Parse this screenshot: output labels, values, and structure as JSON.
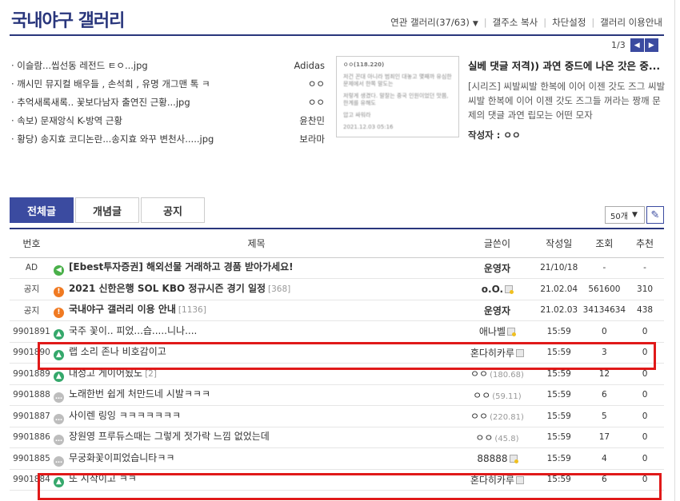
{
  "header": {
    "title": "국내야구 갤러리",
    "nav": [
      "연관 갤러리(37/63)",
      "갤주소 복사",
      "차단설정",
      "갤러리 이용안내"
    ],
    "pager": "1/3"
  },
  "featured": [
    {
      "title": "· 이슬람...씹선동 레전드 ㅌㅇ...jpg",
      "author": "Adidas"
    },
    {
      "title": "· 깨시민 뮤지컬 배우들 , 손석희 , 유명 개그맨 톡 ㅋ",
      "author": "ㅇㅇ"
    },
    {
      "title": "· 추억새록새록.. 꽃보다남자 출연진 근황...jpg",
      "author": "ㅇㅇ"
    },
    {
      "title": "· 속보) 문재앙식 K-방역 근황",
      "author": "윤찬민"
    },
    {
      "title": "· 황당) 송지효 코디논란...송지효 와꾸 변천사.....jpg",
      "author": "보라마"
    }
  ],
  "thumb": {
    "head": "ㅇㅇ(118.220)",
    "lines": [
      "저건 꼰대 아니라 범죄인 대놓고 몇째까 유심한 문제에서 한쪽 말도는",
      "저렇게 생겼다. 말잘는 중국 인원이었던 맛쯤, 한계를 유해도",
      "압고 싸워라",
      "2021.12.03 05:16"
    ]
  },
  "article": {
    "headline": "실베 댓글 저격)) 과연 중드에 나온 갓은 중...",
    "body": "[시리즈] 씨발씨발 한복에 이어 이젠 갓도 즈그 씨발씨발 한복에 이어 이젠 갓도 즈그들 꺼라는 짱깨 문제의 댓글 과연 립모는 어떤 모자",
    "author_label": "작성자 : ",
    "author": "ㅇㅇ"
  },
  "tabs": [
    "전체글",
    "개념글",
    "공지"
  ],
  "list_size": "50개",
  "columns": [
    "번호",
    "제목",
    "글쓴이",
    "작성일",
    "조회",
    "추천"
  ],
  "rows": [
    {
      "no": "AD",
      "icon": "speaker",
      "title": "[Ebest투자증권] 해외선물 거래하고 경품 받아가세요!",
      "bold": true,
      "cc": "",
      "writer": "운영자",
      "ip": "",
      "badge": "",
      "date": "21/10/18",
      "views": "-",
      "rec": "-"
    },
    {
      "no": "공지",
      "icon": "notice",
      "title": "2021 신한은행 SOL KBO 정규시즌 경기 일정",
      "bold": true,
      "cc": "[368]",
      "writer": "o.O.",
      "ip": "",
      "badge": "gold",
      "date": "21.02.04",
      "views": "561600",
      "rec": "310"
    },
    {
      "no": "공지",
      "icon": "notice",
      "title": "국내야구 갤러리 이용 안내",
      "bold": true,
      "cc": "[1136]",
      "writer": "운영자",
      "ip": "",
      "badge": "",
      "date": "21.02.03",
      "views": "34134634",
      "rec": "438"
    },
    {
      "no": "9901891",
      "icon": "img",
      "title": "국주 꽃이.. 피었...습.....니나....",
      "bold": false,
      "cc": "",
      "writer": "애나벨",
      "ip": "",
      "badge": "gold",
      "date": "15:59",
      "views": "0",
      "rec": "0"
    },
    {
      "no": "9901890",
      "icon": "img",
      "title": "랩 소리 존나 비호감이고",
      "bold": false,
      "cc": "",
      "writer": "혼다히카루",
      "ip": "",
      "badge": "gray",
      "date": "15:59",
      "views": "3",
      "rec": "0"
    },
    {
      "no": "9901889",
      "icon": "img",
      "title": "대성고 게이어됬노",
      "bold": false,
      "cc": "[2]",
      "writer": "ㅇㅇ",
      "ip": "(180.68)",
      "badge": "",
      "date": "15:59",
      "views": "12",
      "rec": "0"
    },
    {
      "no": "9901888",
      "icon": "txt",
      "title": "노래한번 쉽게 처만드네 시발ㅋㅋㅋ",
      "bold": false,
      "cc": "",
      "writer": "ㅇㅇ",
      "ip": "(59.11)",
      "badge": "",
      "date": "15:59",
      "views": "6",
      "rec": "0"
    },
    {
      "no": "9901887",
      "icon": "txt",
      "title": "사이렌 링잉 ㅋㅋㅋㅋㅋㅋㅋ",
      "bold": false,
      "cc": "",
      "writer": "ㅇㅇ",
      "ip": "(220.81)",
      "badge": "",
      "date": "15:59",
      "views": "5",
      "rec": "0"
    },
    {
      "no": "9901886",
      "icon": "txt",
      "title": "장원영 프루듀스때는 그렇게 젓가락 느낌 없었는데",
      "bold": false,
      "cc": "",
      "writer": "ㅇㅇ",
      "ip": "(45.8)",
      "badge": "",
      "date": "15:59",
      "views": "17",
      "rec": "0"
    },
    {
      "no": "9901885",
      "icon": "txt",
      "title": "무궁화꽃이피었습니타ㅋㅋ",
      "bold": false,
      "cc": "",
      "writer": "88888",
      "ip": "",
      "badge": "gold",
      "date": "15:59",
      "views": "4",
      "rec": "0"
    },
    {
      "no": "9901884",
      "icon": "img",
      "title": "또 시작이고 ㅋㅋ",
      "bold": false,
      "cc": "",
      "writer": "혼다히카루",
      "ip": "",
      "badge": "gray",
      "date": "15:59",
      "views": "6",
      "rec": "0"
    }
  ],
  "colors": {
    "brand": "#29367c",
    "tab_active": "#3b4ba0",
    "highlight": "#e01919"
  }
}
